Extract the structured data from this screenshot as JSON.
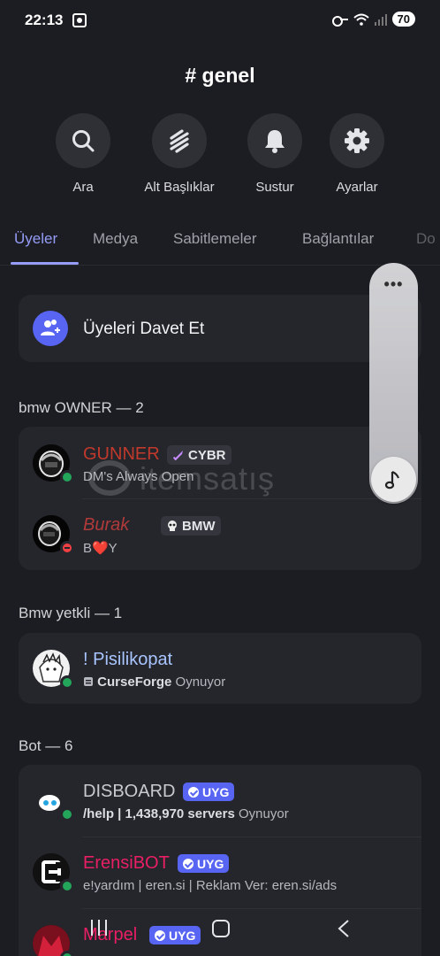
{
  "status": {
    "time": "22:13",
    "battery": "70"
  },
  "channel": {
    "title": "# genel"
  },
  "actions": [
    {
      "label": "Ara",
      "icon": "search-icon"
    },
    {
      "label": "Alt Başlıklar",
      "icon": "threads-icon"
    },
    {
      "label": "Sustur",
      "icon": "bell-icon"
    },
    {
      "label": "Ayarlar",
      "icon": "gear-icon"
    }
  ],
  "tabs": [
    {
      "label": "Üyeler",
      "active": true
    },
    {
      "label": "Medya"
    },
    {
      "label": "Sabitlemeler"
    },
    {
      "label": "Bağlantılar"
    },
    {
      "label": "Do"
    }
  ],
  "invite": {
    "label": "Üyeleri Davet Et"
  },
  "sections": [
    {
      "title": "bmw OWNER — 2",
      "members": [
        {
          "name": "GUNNER",
          "tag": "CYBR",
          "sub": "DM's Always Open",
          "status": "online"
        },
        {
          "name": "Burak",
          "tag": "BMW",
          "sub": "B❤️Y",
          "status": "dnd"
        }
      ]
    },
    {
      "title": "Bmw yetkli — 1",
      "members": [
        {
          "name": "! Pisilikopat",
          "sub_app": "CurseForge",
          "sub_suffix": "Oynuyor",
          "status": "online"
        }
      ]
    },
    {
      "title": "Bot — 6",
      "members": [
        {
          "name": "DISBOARD",
          "tag": "UYG",
          "sub_prefix": "/help | 1,438,970 servers",
          "sub_suffix": "Oynuyor",
          "status": "online"
        },
        {
          "name": "ErensiBOT",
          "tag": "UYG",
          "sub": "e!yardım | eren.si | Reklam Ver: eren.si/ads",
          "status": "online"
        },
        {
          "name": "Marpel",
          "tag": "UYG",
          "status": "online"
        }
      ]
    }
  ],
  "watermark": {
    "text": "itemsatış"
  },
  "colors": {
    "accent": "#949cf7",
    "blurple": "#5865f2",
    "owner_role": "#c0392b",
    "mod_role": "#a9c5ff",
    "bot_default": "#c8cad0",
    "erensi_role": "#e91e63"
  }
}
